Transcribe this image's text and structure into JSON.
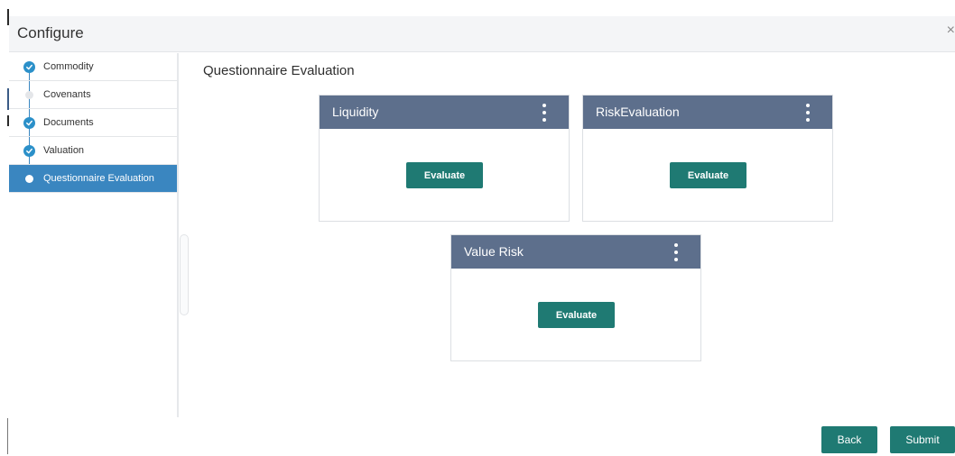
{
  "window": {
    "title": "Configure",
    "close_glyph": "×"
  },
  "sidebar": {
    "steps": [
      {
        "label": "Commodity",
        "status": "completed"
      },
      {
        "label": "Covenants",
        "status": "pending"
      },
      {
        "label": "Documents",
        "status": "completed"
      },
      {
        "label": "Valuation",
        "status": "completed"
      },
      {
        "label": "Questionnaire Evaluation",
        "status": "current"
      }
    ]
  },
  "main": {
    "section_title": "Questionnaire Evaluation",
    "cards": [
      {
        "title": "Liquidity",
        "action_label": "Evaluate"
      },
      {
        "title": "RiskEvaluation",
        "action_label": "Evaluate"
      },
      {
        "title": "Value Risk",
        "action_label": "Evaluate"
      }
    ]
  },
  "footer": {
    "back_label": "Back",
    "submit_label": "Submit"
  },
  "colors": {
    "header_bg": "#f4f5f7",
    "card_header": "#5d6f8c",
    "primary_button": "#1f7a73",
    "active_step": "#3a86c0",
    "step_complete": "#2b90c9"
  }
}
